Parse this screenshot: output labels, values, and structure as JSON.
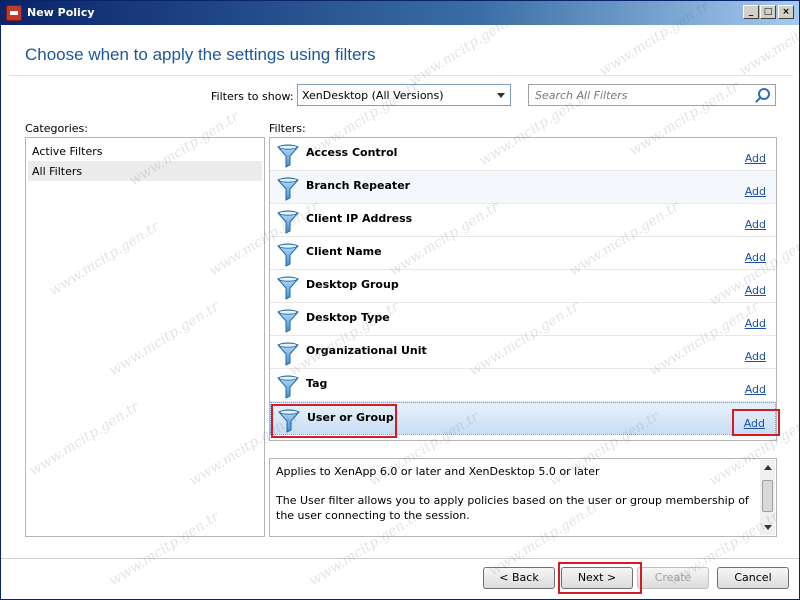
{
  "window": {
    "title": "New Policy"
  },
  "titlebar_buttons": {
    "minimize": "_",
    "maximize": "□",
    "close": "×"
  },
  "heading": "Choose when to apply the settings using filters",
  "filter_bar": {
    "label": "Filters to show:",
    "selected": "XenDesktop (All Versions)",
    "search_placeholder": "Search All Filters"
  },
  "categories": {
    "label": "Categories:",
    "items": [
      {
        "label": "Active Filters",
        "selected": false
      },
      {
        "label": "All Filters",
        "selected": true
      }
    ]
  },
  "filters": {
    "label": "Filters:",
    "add_label": "Add",
    "items": [
      {
        "name": "Access Control"
      },
      {
        "name": "Branch Repeater"
      },
      {
        "name": "Client IP Address"
      },
      {
        "name": "Client Name"
      },
      {
        "name": "Desktop Group"
      },
      {
        "name": "Desktop Type"
      },
      {
        "name": "Organizational Unit"
      },
      {
        "name": "Tag"
      },
      {
        "name": "User or Group"
      }
    ],
    "selected_index": 8
  },
  "description": {
    "applies": "Applies to XenApp 6.0 or later and XenDesktop 5.0 or later",
    "text": "The User filter allows you to apply policies based on the user or group membership of the user connecting to the session."
  },
  "buttons": {
    "back": "< Back",
    "next": "Next >",
    "create": "Create",
    "cancel": "Cancel"
  },
  "watermark": "www.mcitp.gen.tr",
  "colors": {
    "heading": "#1e5799",
    "link": "#1a4fa3",
    "highlight": "#d51b25",
    "selected_row": "#c9ddf4"
  },
  "icons": {
    "filter": "funnel-icon",
    "search": "search-icon",
    "dropdown": "chevron-down-icon"
  }
}
